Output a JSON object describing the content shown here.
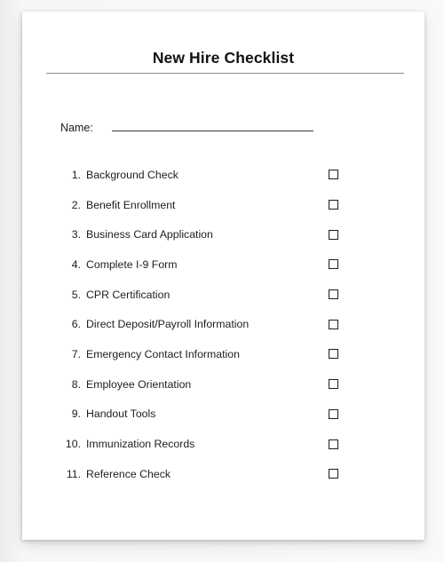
{
  "document": {
    "title": "New Hire Checklist",
    "name_field": {
      "label": "Name:",
      "value": "",
      "placeholder": ""
    },
    "checklist_items": [
      {
        "number": "1.",
        "label": "Background Check",
        "checked": false
      },
      {
        "number": "2.",
        "label": "Benefit Enrollment",
        "checked": false
      },
      {
        "number": "3.",
        "label": "Business Card Application",
        "checked": false
      },
      {
        "number": "4.",
        "label": "Complete I-9 Form",
        "checked": false
      },
      {
        "number": "5.",
        "label": "CPR Certification",
        "checked": false
      },
      {
        "number": "6.",
        "label": "Direct Deposit/Payroll Information",
        "checked": false
      },
      {
        "number": "7.",
        "label": "Emergency Contact Information",
        "checked": false
      },
      {
        "number": "8.",
        "label": "Employee Orientation",
        "checked": false
      },
      {
        "number": "9.",
        "label": "Handout Tools",
        "checked": false
      },
      {
        "number": "10.",
        "label": "Immunization Records",
        "checked": false
      },
      {
        "number": "11.",
        "label": "Reference Check",
        "checked": false
      }
    ]
  },
  "colors": {
    "page_background": "#ffffff",
    "canvas_background": "#f8f8f8",
    "text": "#1d1d1d",
    "title_rule": "#8b8b8d",
    "checkbox_border": "#1c1c1c",
    "name_line": "#3a3a3a"
  }
}
